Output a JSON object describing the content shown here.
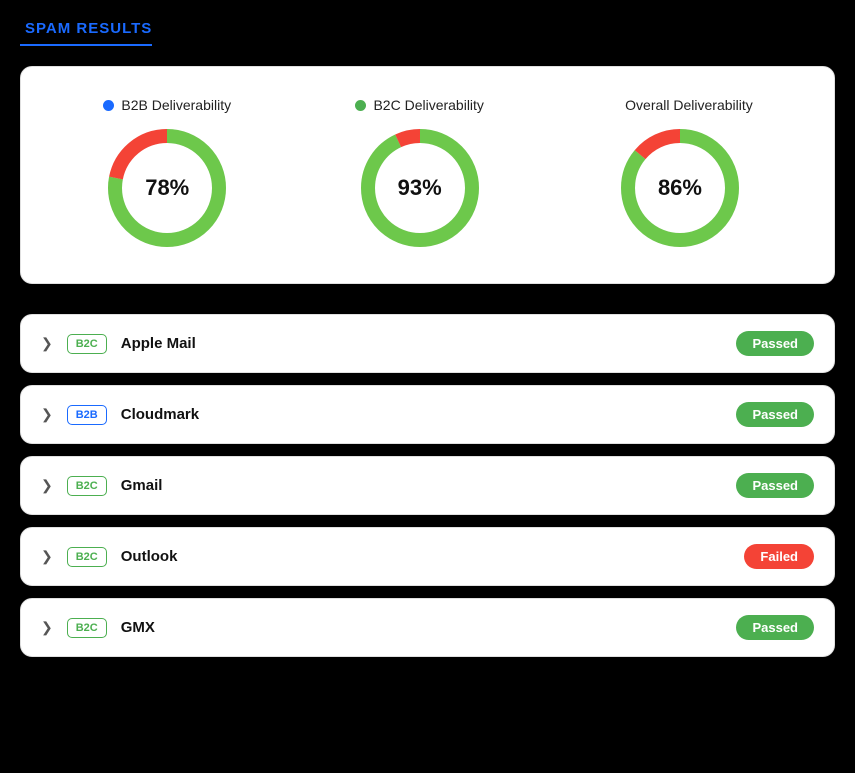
{
  "header": {
    "title": "SPAM RESULTS"
  },
  "charts": [
    {
      "id": "b2b",
      "label": "B2B Deliverability",
      "dot_color": "#1a6aff",
      "percentage": 78,
      "percentage_label": "78%",
      "green_color": "#6dc84b",
      "red_color": "#f44336",
      "track_color": "#e8e8e8"
    },
    {
      "id": "b2c",
      "label": "B2C Deliverability",
      "dot_color": "#4caf50",
      "percentage": 93,
      "percentage_label": "93%",
      "green_color": "#6dc84b",
      "red_color": "#f44336",
      "track_color": "#e8e8e8"
    },
    {
      "id": "overall",
      "label": "Overall Deliverability",
      "dot_color": null,
      "percentage": 86,
      "percentage_label": "86%",
      "green_color": "#6dc84b",
      "red_color": "#f44336",
      "track_color": "#e8e8e8"
    }
  ],
  "list_items": [
    {
      "id": "apple-mail",
      "tag": "B2C",
      "tag_type": "b2c",
      "name": "Apple Mail",
      "status": "Passed",
      "status_type": "passed"
    },
    {
      "id": "cloudmark",
      "tag": "B2B",
      "tag_type": "b2b",
      "name": "Cloudmark",
      "status": "Passed",
      "status_type": "passed"
    },
    {
      "id": "gmail",
      "tag": "B2C",
      "tag_type": "b2c",
      "name": "Gmail",
      "status": "Passed",
      "status_type": "passed"
    },
    {
      "id": "outlook",
      "tag": "B2C",
      "tag_type": "b2c",
      "name": "Outlook",
      "status": "Failed",
      "status_type": "failed"
    },
    {
      "id": "gmx",
      "tag": "B2C",
      "tag_type": "b2c",
      "name": "GMX",
      "status": "Passed",
      "status_type": "passed"
    }
  ],
  "icons": {
    "chevron": "❯"
  }
}
